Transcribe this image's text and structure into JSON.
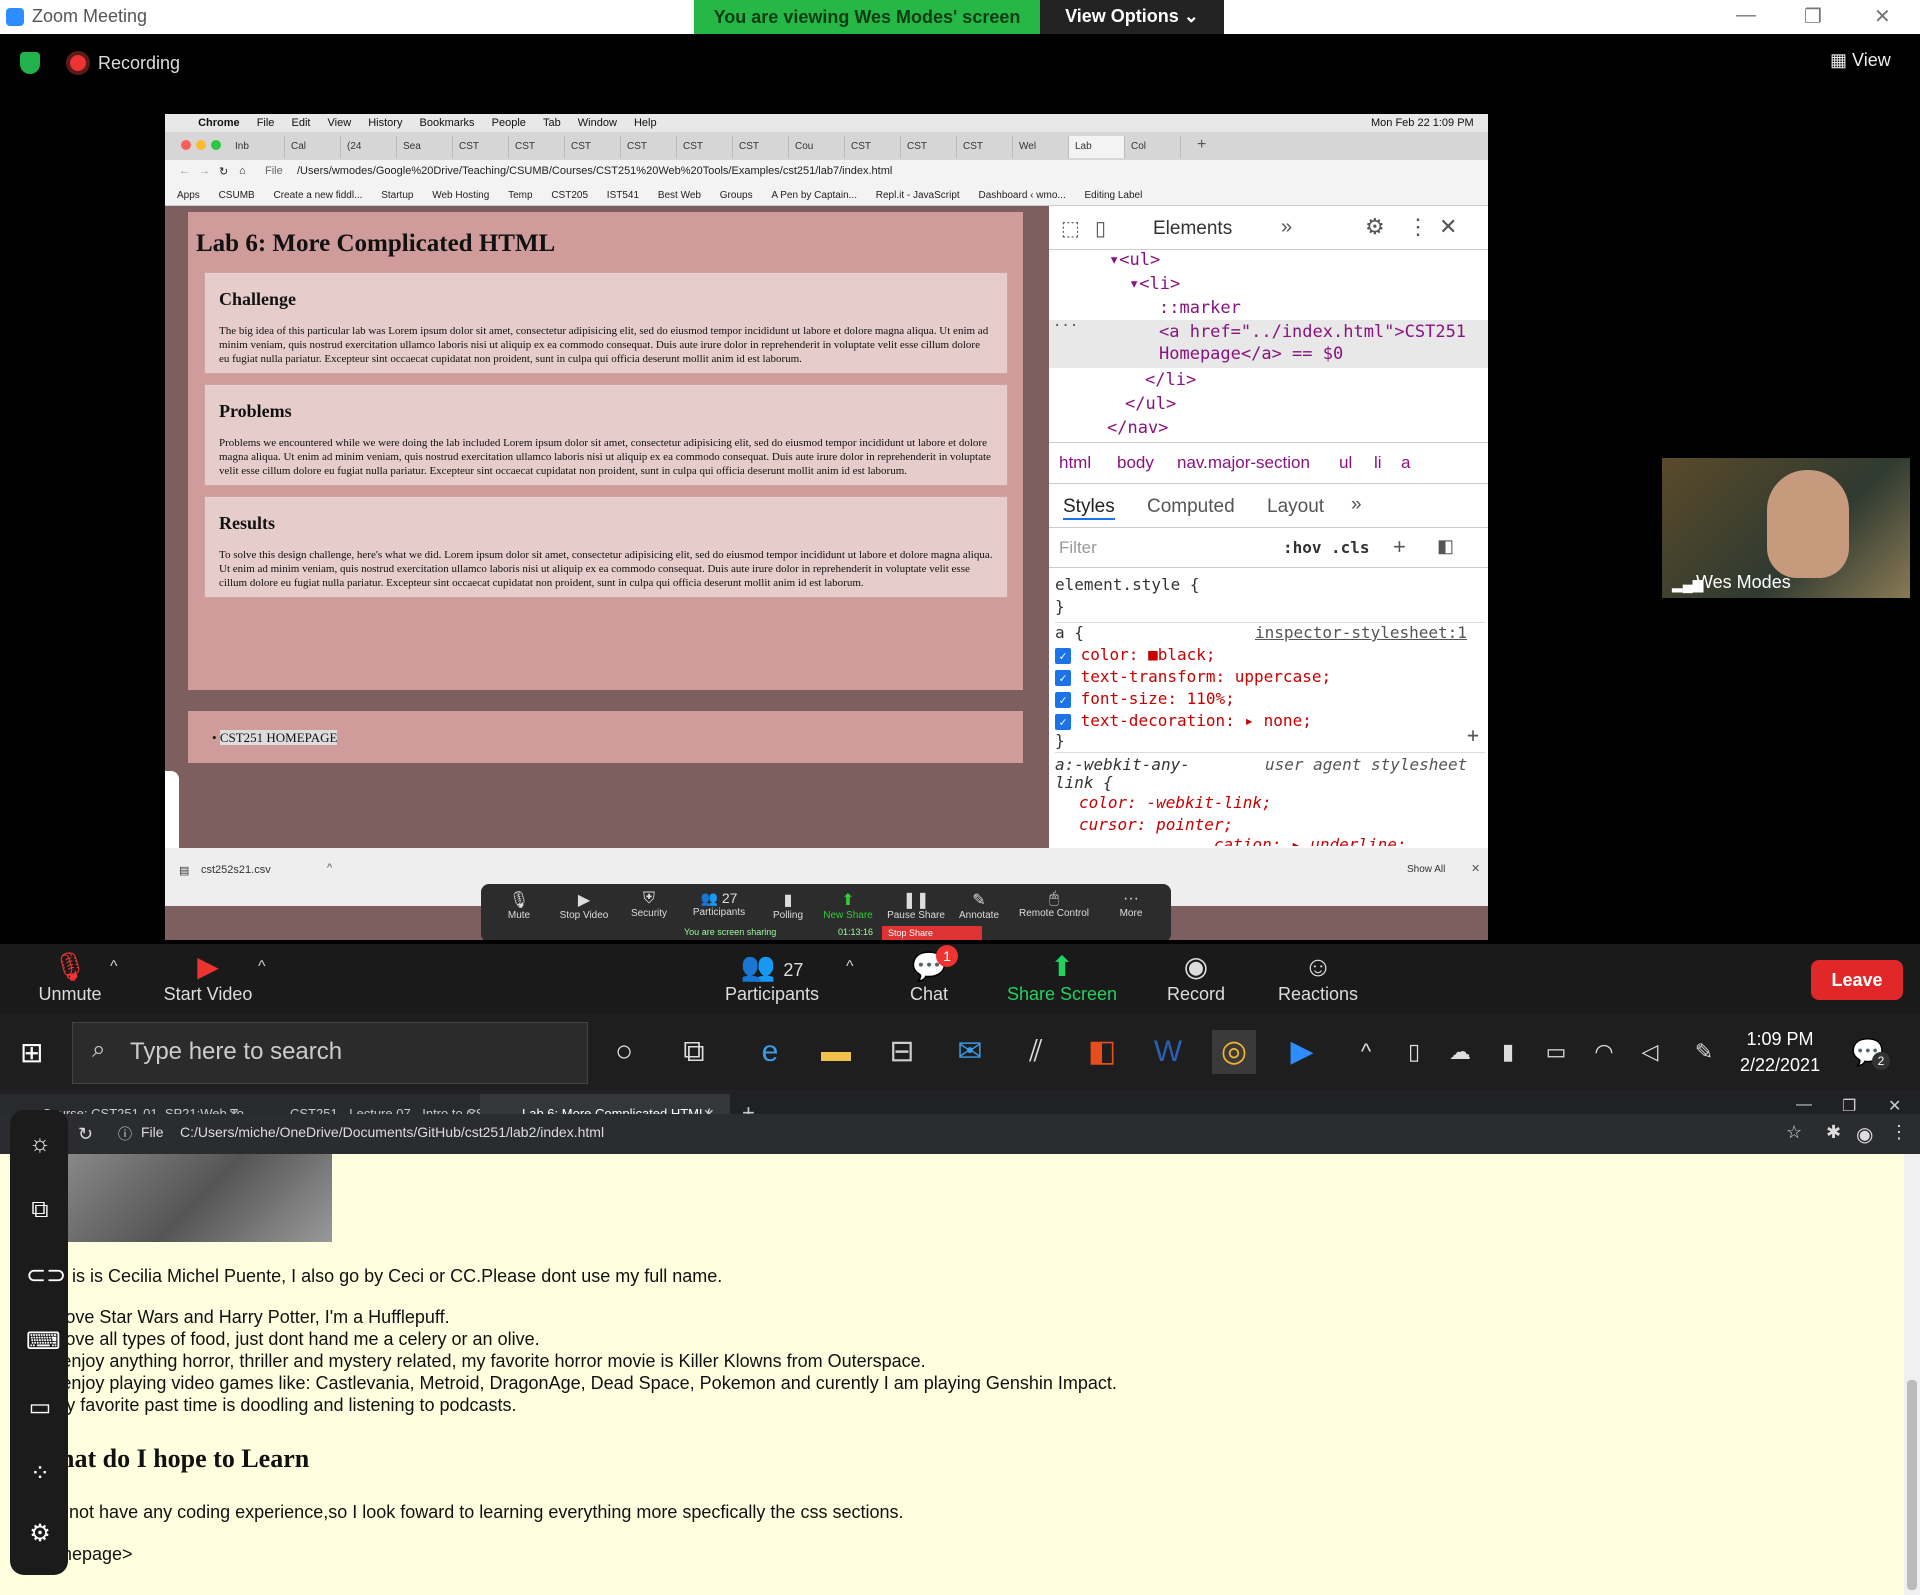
{
  "zoom": {
    "window_title": "Zoom Meeting",
    "viewing_banner": "You are viewing Wes Modes' screen",
    "view_options": "View Options",
    "recording": "Recording",
    "view": "View",
    "participant_name": "Wes Modes",
    "controls": {
      "unmute": "Unmute",
      "start_video": "Start Video",
      "participants": "Participants",
      "participants_count": "27",
      "chat": "Chat",
      "chat_badge": "1",
      "share_screen": "Share Screen",
      "record": "Record",
      "reactions": "Reactions",
      "leave": "Leave"
    }
  },
  "mac": {
    "menu": [
      "Chrome",
      "File",
      "Edit",
      "View",
      "History",
      "Bookmarks",
      "People",
      "Tab",
      "Window",
      "Help"
    ],
    "clock": "Mon Feb 22  1:09 PM",
    "tabs": [
      "Inb",
      "Cal",
      "(24",
      "Sea",
      "CST",
      "CST",
      "CST",
      "CST",
      "CST",
      "CST",
      "Cou",
      "CST",
      "CST",
      "CST",
      "Wel",
      "Lab",
      "Col"
    ],
    "file_label": "File",
    "url": "/Users/wmodes/Google%20Drive/Teaching/CSUMB/Courses/CST251%20Web%20Tools/Examples/cst251/lab7/index.html",
    "bookmarks": [
      "Apps",
      "CSUMB",
      "Create a new fiddl...",
      "Startup",
      "Web Hosting",
      "Temp",
      "CST205",
      "IST541",
      "Best Web",
      "Groups",
      "A Pen by Captain...",
      "Repl.it - JavaScript",
      "Dashboard ‹ wmo...",
      "Editing Label"
    ],
    "download_file": "cst252s21.csv",
    "show_all": "Show All"
  },
  "lab": {
    "title": "Lab 6: More Complicated HTML",
    "sections": [
      {
        "heading": "Challenge",
        "text": "The big idea of this particular lab was Lorem ipsum dolor sit amet, consectetur adipisicing elit, sed do eiusmod tempor incididunt ut labore et dolore magna aliqua. Ut enim ad minim veniam, quis nostrud exercitation ullamco laboris nisi ut aliquip ex ea commodo consequat. Duis aute irure dolor in reprehenderit in voluptate velit esse cillum dolore eu fugiat nulla pariatur. Excepteur sint occaecat cupidatat non proident, sunt in culpa qui officia deserunt mollit anim id est laborum."
      },
      {
        "heading": "Problems",
        "text": "Problems we encountered while we were doing the lab included Lorem ipsum dolor sit amet, consectetur adipisicing elit, sed do eiusmod tempor incididunt ut labore et dolore magna aliqua. Ut enim ad minim veniam, quis nostrud exercitation ullamco laboris nisi ut aliquip ex ea commodo consequat. Duis aute irure dolor in reprehenderit in voluptate velit esse cillum dolore eu fugiat nulla pariatur. Excepteur sint occaecat cupidatat non proident, sunt in culpa qui officia deserunt mollit anim id est laborum."
      },
      {
        "heading": "Results",
        "text": "To solve this design challenge, here's what we did. Lorem ipsum dolor sit amet, consectetur adipisicing elit, sed do eiusmod tempor incididunt ut labore et dolore magna aliqua. Ut enim ad minim veniam, quis nostrud exercitation ullamco laboris nisi ut aliquip ex ea commodo consequat. Duis aute irure dolor in reprehenderit in voluptate velit esse cillum dolore eu fugiat nulla pariatur. Excepteur sint occaecat cupidatat non proident, sunt in culpa qui officia deserunt mollit anim id est laborum."
      }
    ],
    "nav_link": "CST251 HOMEPAGE"
  },
  "devtools": {
    "tab": "Elements",
    "dom": {
      "ul_open": "<ul>",
      "li_open": "<li>",
      "marker": "::marker",
      "a_tag": "<a href=\"../index.html\">CST251",
      "a_text": "Homepage</a> == $0",
      "li_close": "</li>",
      "ul_close": "</ul>",
      "nav_close": "</nav>"
    },
    "breadcrumbs": [
      "html",
      "body",
      "nav.major-section",
      "ul",
      "li",
      "a"
    ],
    "panel_tabs": [
      "Styles",
      "Computed",
      "Layout",
      "»"
    ],
    "filter_placeholder": "Filter",
    "hov": ":hov",
    "cls": ".cls",
    "element_style": "element.style {",
    "close_brace": "}",
    "rule_selector": "a {",
    "rule_source": "inspector-stylesheet:1",
    "props": [
      "color: ■black;",
      "text-transform: uppercase;",
      "font-size: 110%;",
      "text-decoration: ▸ none;"
    ],
    "ua_selector": "a:-webkit-any-",
    "ua_selector2": "link {",
    "ua_source": "user agent stylesheet",
    "ua_props": [
      "color: -webkit-link;",
      "cursor: pointer;",
      "...cation: ▸ underline;"
    ]
  },
  "zoom_float": {
    "items": [
      "Mute",
      "Stop Video",
      "Security",
      "Participants",
      "Polling",
      "New Share",
      "Pause Share",
      "Annotate",
      "Remote Control",
      "More"
    ],
    "participants_count": "27",
    "sharing": "You are screen sharing",
    "timer": "01:13:16",
    "stop_share": "Stop Share"
  },
  "taskbar": {
    "search_placeholder": "Type here to search",
    "time": "1:09 PM",
    "date": "2/22/2021",
    "notif_count": "2"
  },
  "chrome_bottom": {
    "tabs": [
      "Course: CST251-01_SP21:Web To",
      "CST251 - Lecture 07 - Intro to CS",
      "Lab 6: More Complicated HTML/"
    ],
    "file_label": "File",
    "url": "C:/Users/miche/OneDrive/Documents/GitHub/cst251/lab2/index.html",
    "intro": "is is Cecilia Michel Puente, I also go by Ceci or CC.Please dont use my full name.",
    "list": [
      "I love Star Wars and Harry Potter, I'm a Hufflepuff.",
      "I love all types of food, just dont hand me a celery or an olive.",
      "I enjoy anything horror, thriller and mystery related, my favorite horror movie is Killer Klowns from Outerspace.",
      "I enjoy playing video games like: Castlevania, Metroid, DragonAge, Dead Space, Pokemon and curently I am playing Genshin Impact.",
      "My favorite past time is doodling and listening to podcasts."
    ],
    "heading": "What do I hope to Learn",
    "paragraph": "I do not have any coding experience,so I look foward to learning everything more specfically the css sections.",
    "homepage": "Homepage>"
  }
}
